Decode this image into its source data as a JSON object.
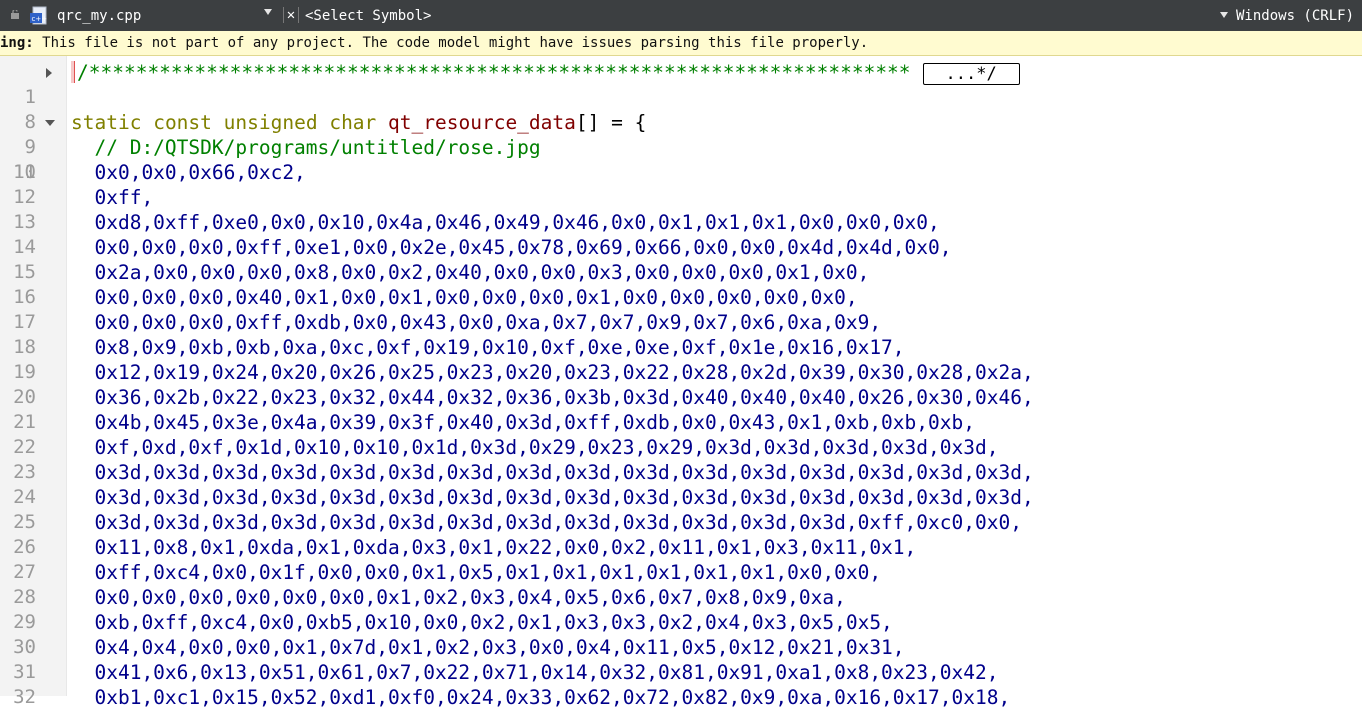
{
  "toolbar": {
    "filename": "qrc_my.cpp",
    "close_glyph": "✕",
    "symbol_placeholder": "<Select Symbol>",
    "line_endings": "Windows (CRLF)"
  },
  "warning": {
    "prefix": "ing:",
    "message": " This file is not part of any project. The code model might have issues parsing this file properly."
  },
  "editor": {
    "line1": {
      "num": "1",
      "stars": "/**********************************************************************",
      "fold_label": "...*/"
    },
    "line8": {
      "num": "8"
    },
    "line9": {
      "num": "9",
      "kw1": "static",
      "kw2": "const",
      "kw3": "unsigned",
      "kw4": "char",
      "ident": "qt_resource_data",
      "rest": "[] = {"
    },
    "line10": {
      "num": "10",
      "text": "  // D:/QTSDK/programs/untitled/rose.jpg"
    },
    "rows": [
      {
        "num": "11",
        "text": "  0x0,0x0,0x66,0xc2,"
      },
      {
        "num": "12",
        "text": "  0xff,"
      },
      {
        "num": "13",
        "text": "  0xd8,0xff,0xe0,0x0,0x10,0x4a,0x46,0x49,0x46,0x0,0x1,0x1,0x1,0x0,0x0,0x0,"
      },
      {
        "num": "14",
        "text": "  0x0,0x0,0x0,0xff,0xe1,0x0,0x2e,0x45,0x78,0x69,0x66,0x0,0x0,0x4d,0x4d,0x0,"
      },
      {
        "num": "15",
        "text": "  0x2a,0x0,0x0,0x0,0x8,0x0,0x2,0x40,0x0,0x0,0x3,0x0,0x0,0x0,0x1,0x0,"
      },
      {
        "num": "16",
        "text": "  0x0,0x0,0x0,0x40,0x1,0x0,0x1,0x0,0x0,0x0,0x1,0x0,0x0,0x0,0x0,0x0,"
      },
      {
        "num": "17",
        "text": "  0x0,0x0,0x0,0xff,0xdb,0x0,0x43,0x0,0xa,0x7,0x7,0x9,0x7,0x6,0xa,0x9,"
      },
      {
        "num": "18",
        "text": "  0x8,0x9,0xb,0xb,0xa,0xc,0xf,0x19,0x10,0xf,0xe,0xe,0xf,0x1e,0x16,0x17,"
      },
      {
        "num": "19",
        "text": "  0x12,0x19,0x24,0x20,0x26,0x25,0x23,0x20,0x23,0x22,0x28,0x2d,0x39,0x30,0x28,0x2a,"
      },
      {
        "num": "20",
        "text": "  0x36,0x2b,0x22,0x23,0x32,0x44,0x32,0x36,0x3b,0x3d,0x40,0x40,0x40,0x26,0x30,0x46,"
      },
      {
        "num": "21",
        "text": "  0x4b,0x45,0x3e,0x4a,0x39,0x3f,0x40,0x3d,0xff,0xdb,0x0,0x43,0x1,0xb,0xb,0xb,"
      },
      {
        "num": "22",
        "text": "  0xf,0xd,0xf,0x1d,0x10,0x10,0x1d,0x3d,0x29,0x23,0x29,0x3d,0x3d,0x3d,0x3d,0x3d,"
      },
      {
        "num": "23",
        "text": "  0x3d,0x3d,0x3d,0x3d,0x3d,0x3d,0x3d,0x3d,0x3d,0x3d,0x3d,0x3d,0x3d,0x3d,0x3d,0x3d,"
      },
      {
        "num": "24",
        "text": "  0x3d,0x3d,0x3d,0x3d,0x3d,0x3d,0x3d,0x3d,0x3d,0x3d,0x3d,0x3d,0x3d,0x3d,0x3d,0x3d,"
      },
      {
        "num": "25",
        "text": "  0x3d,0x3d,0x3d,0x3d,0x3d,0x3d,0x3d,0x3d,0x3d,0x3d,0x3d,0x3d,0x3d,0xff,0xc0,0x0,"
      },
      {
        "num": "26",
        "text": "  0x11,0x8,0x1,0xda,0x1,0xda,0x3,0x1,0x22,0x0,0x2,0x11,0x1,0x3,0x11,0x1,"
      },
      {
        "num": "27",
        "text": "  0xff,0xc4,0x0,0x1f,0x0,0x0,0x1,0x5,0x1,0x1,0x1,0x1,0x1,0x1,0x0,0x0,"
      },
      {
        "num": "28",
        "text": "  0x0,0x0,0x0,0x0,0x0,0x0,0x1,0x2,0x3,0x4,0x5,0x6,0x7,0x8,0x9,0xa,"
      },
      {
        "num": "29",
        "text": "  0xb,0xff,0xc4,0x0,0xb5,0x10,0x0,0x2,0x1,0x3,0x3,0x2,0x4,0x3,0x5,0x5,"
      },
      {
        "num": "30",
        "text": "  0x4,0x4,0x0,0x0,0x1,0x7d,0x1,0x2,0x3,0x0,0x4,0x11,0x5,0x12,0x21,0x31,"
      },
      {
        "num": "31",
        "text": "  0x41,0x6,0x13,0x51,0x61,0x7,0x22,0x71,0x14,0x32,0x81,0x91,0xa1,0x8,0x23,0x42,"
      },
      {
        "num": "32",
        "text": "  0xb1,0xc1,0x15,0x52,0xd1,0xf0,0x24,0x33,0x62,0x72,0x82,0x9,0xa,0x16,0x17,0x18,"
      }
    ]
  }
}
